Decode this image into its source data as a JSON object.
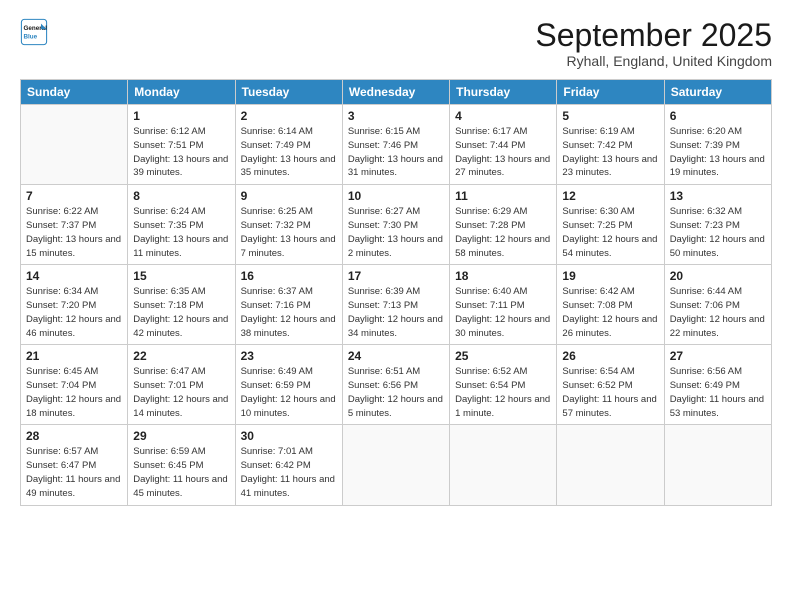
{
  "header": {
    "logo_line1": "General",
    "logo_line2": "Blue",
    "title": "September 2025",
    "subtitle": "Ryhall, England, United Kingdom"
  },
  "days_of_week": [
    "Sunday",
    "Monday",
    "Tuesday",
    "Wednesday",
    "Thursday",
    "Friday",
    "Saturday"
  ],
  "weeks": [
    [
      {
        "num": "",
        "sunrise": "",
        "sunset": "",
        "daylight": ""
      },
      {
        "num": "1",
        "sunrise": "Sunrise: 6:12 AM",
        "sunset": "Sunset: 7:51 PM",
        "daylight": "Daylight: 13 hours and 39 minutes."
      },
      {
        "num": "2",
        "sunrise": "Sunrise: 6:14 AM",
        "sunset": "Sunset: 7:49 PM",
        "daylight": "Daylight: 13 hours and 35 minutes."
      },
      {
        "num": "3",
        "sunrise": "Sunrise: 6:15 AM",
        "sunset": "Sunset: 7:46 PM",
        "daylight": "Daylight: 13 hours and 31 minutes."
      },
      {
        "num": "4",
        "sunrise": "Sunrise: 6:17 AM",
        "sunset": "Sunset: 7:44 PM",
        "daylight": "Daylight: 13 hours and 27 minutes."
      },
      {
        "num": "5",
        "sunrise": "Sunrise: 6:19 AM",
        "sunset": "Sunset: 7:42 PM",
        "daylight": "Daylight: 13 hours and 23 minutes."
      },
      {
        "num": "6",
        "sunrise": "Sunrise: 6:20 AM",
        "sunset": "Sunset: 7:39 PM",
        "daylight": "Daylight: 13 hours and 19 minutes."
      }
    ],
    [
      {
        "num": "7",
        "sunrise": "Sunrise: 6:22 AM",
        "sunset": "Sunset: 7:37 PM",
        "daylight": "Daylight: 13 hours and 15 minutes."
      },
      {
        "num": "8",
        "sunrise": "Sunrise: 6:24 AM",
        "sunset": "Sunset: 7:35 PM",
        "daylight": "Daylight: 13 hours and 11 minutes."
      },
      {
        "num": "9",
        "sunrise": "Sunrise: 6:25 AM",
        "sunset": "Sunset: 7:32 PM",
        "daylight": "Daylight: 13 hours and 7 minutes."
      },
      {
        "num": "10",
        "sunrise": "Sunrise: 6:27 AM",
        "sunset": "Sunset: 7:30 PM",
        "daylight": "Daylight: 13 hours and 2 minutes."
      },
      {
        "num": "11",
        "sunrise": "Sunrise: 6:29 AM",
        "sunset": "Sunset: 7:28 PM",
        "daylight": "Daylight: 12 hours and 58 minutes."
      },
      {
        "num": "12",
        "sunrise": "Sunrise: 6:30 AM",
        "sunset": "Sunset: 7:25 PM",
        "daylight": "Daylight: 12 hours and 54 minutes."
      },
      {
        "num": "13",
        "sunrise": "Sunrise: 6:32 AM",
        "sunset": "Sunset: 7:23 PM",
        "daylight": "Daylight: 12 hours and 50 minutes."
      }
    ],
    [
      {
        "num": "14",
        "sunrise": "Sunrise: 6:34 AM",
        "sunset": "Sunset: 7:20 PM",
        "daylight": "Daylight: 12 hours and 46 minutes."
      },
      {
        "num": "15",
        "sunrise": "Sunrise: 6:35 AM",
        "sunset": "Sunset: 7:18 PM",
        "daylight": "Daylight: 12 hours and 42 minutes."
      },
      {
        "num": "16",
        "sunrise": "Sunrise: 6:37 AM",
        "sunset": "Sunset: 7:16 PM",
        "daylight": "Daylight: 12 hours and 38 minutes."
      },
      {
        "num": "17",
        "sunrise": "Sunrise: 6:39 AM",
        "sunset": "Sunset: 7:13 PM",
        "daylight": "Daylight: 12 hours and 34 minutes."
      },
      {
        "num": "18",
        "sunrise": "Sunrise: 6:40 AM",
        "sunset": "Sunset: 7:11 PM",
        "daylight": "Daylight: 12 hours and 30 minutes."
      },
      {
        "num": "19",
        "sunrise": "Sunrise: 6:42 AM",
        "sunset": "Sunset: 7:08 PM",
        "daylight": "Daylight: 12 hours and 26 minutes."
      },
      {
        "num": "20",
        "sunrise": "Sunrise: 6:44 AM",
        "sunset": "Sunset: 7:06 PM",
        "daylight": "Daylight: 12 hours and 22 minutes."
      }
    ],
    [
      {
        "num": "21",
        "sunrise": "Sunrise: 6:45 AM",
        "sunset": "Sunset: 7:04 PM",
        "daylight": "Daylight: 12 hours and 18 minutes."
      },
      {
        "num": "22",
        "sunrise": "Sunrise: 6:47 AM",
        "sunset": "Sunset: 7:01 PM",
        "daylight": "Daylight: 12 hours and 14 minutes."
      },
      {
        "num": "23",
        "sunrise": "Sunrise: 6:49 AM",
        "sunset": "Sunset: 6:59 PM",
        "daylight": "Daylight: 12 hours and 10 minutes."
      },
      {
        "num": "24",
        "sunrise": "Sunrise: 6:51 AM",
        "sunset": "Sunset: 6:56 PM",
        "daylight": "Daylight: 12 hours and 5 minutes."
      },
      {
        "num": "25",
        "sunrise": "Sunrise: 6:52 AM",
        "sunset": "Sunset: 6:54 PM",
        "daylight": "Daylight: 12 hours and 1 minute."
      },
      {
        "num": "26",
        "sunrise": "Sunrise: 6:54 AM",
        "sunset": "Sunset: 6:52 PM",
        "daylight": "Daylight: 11 hours and 57 minutes."
      },
      {
        "num": "27",
        "sunrise": "Sunrise: 6:56 AM",
        "sunset": "Sunset: 6:49 PM",
        "daylight": "Daylight: 11 hours and 53 minutes."
      }
    ],
    [
      {
        "num": "28",
        "sunrise": "Sunrise: 6:57 AM",
        "sunset": "Sunset: 6:47 PM",
        "daylight": "Daylight: 11 hours and 49 minutes."
      },
      {
        "num": "29",
        "sunrise": "Sunrise: 6:59 AM",
        "sunset": "Sunset: 6:45 PM",
        "daylight": "Daylight: 11 hours and 45 minutes."
      },
      {
        "num": "30",
        "sunrise": "Sunrise: 7:01 AM",
        "sunset": "Sunset: 6:42 PM",
        "daylight": "Daylight: 11 hours and 41 minutes."
      },
      {
        "num": "",
        "sunrise": "",
        "sunset": "",
        "daylight": ""
      },
      {
        "num": "",
        "sunrise": "",
        "sunset": "",
        "daylight": ""
      },
      {
        "num": "",
        "sunrise": "",
        "sunset": "",
        "daylight": ""
      },
      {
        "num": "",
        "sunrise": "",
        "sunset": "",
        "daylight": ""
      }
    ]
  ]
}
